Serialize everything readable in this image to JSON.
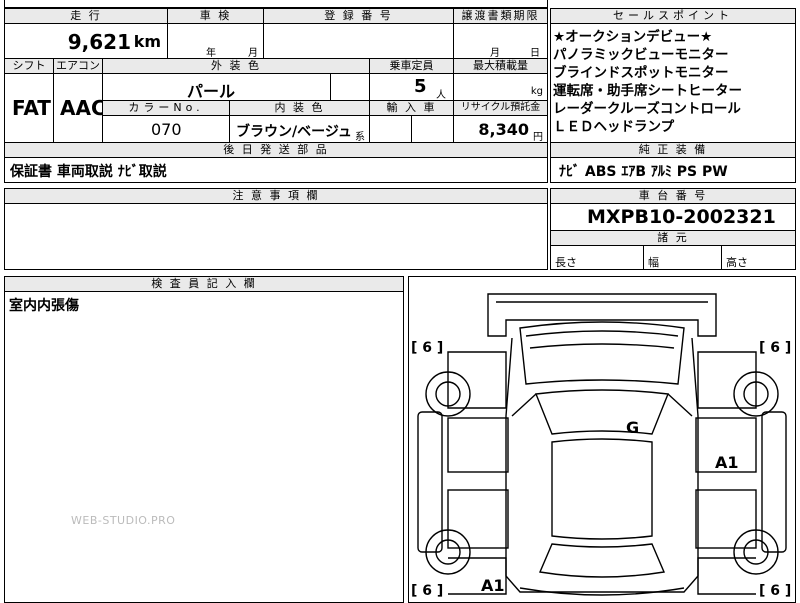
{
  "top_row": {
    "mileage_label": "走 行",
    "shaken_label": "車 検",
    "registration_label": "登 録 番 号",
    "transfer_label": "譲渡書類期限",
    "sales_label": "セールスポイント"
  },
  "mileage": {
    "value": "9,621",
    "unit": "km"
  },
  "shaken": {
    "year": "年",
    "month": "月"
  },
  "transfer": {
    "month": "月",
    "day": "日"
  },
  "row2": {
    "shift_label": "シフト",
    "ac_label": "エアコン",
    "ext_color_label": "外 装 色",
    "capacity_label": "乗車定員",
    "max_load_label": "最大積載量"
  },
  "shift": "FAT",
  "ac": "AAC",
  "ext_color": "パール",
  "capacity": {
    "value": "5",
    "unit": "人"
  },
  "max_load_unit": "kg",
  "row3": {
    "color_no_label": "カラーNo.",
    "int_color_label": "内 装 色",
    "import_label": "輸 入 車",
    "recycle_label": "リサイクル預託金"
  },
  "color_no": "070",
  "int_color": {
    "value": "ブラウン/ベージュ",
    "suffix": "系"
  },
  "recycle": {
    "value": "8,340",
    "unit": "円"
  },
  "later_parts_label": "後 日 発 送 部 品",
  "later_parts": "保証書 車両取説 ﾅﾋﾞ取説",
  "sales_points": [
    "★オークションデビュー★",
    "パノラミックビューモニター",
    "ブラインドスポットモニター",
    "運転席・助手席シートヒーター",
    "レーダークルーズコントロール",
    "ＬＥＤヘッドランプ"
  ],
  "genuine_equipment_label": "純 正 装 備",
  "genuine_equipment": "ﾅﾋﾞ ABS ｴｱB ｱﾙﾐ PS PW",
  "notes_label": "注 意 事 項 欄",
  "chassis_label": "車 台 番 号",
  "chassis_number": "MXPB10-2002321",
  "dimensions_label": "諸 元",
  "dimensions": {
    "length": "長さ",
    "width": "幅",
    "height": "高さ"
  },
  "inspector_label": "検 査 員 記 入 欄",
  "inspector_note": "室内内張傷",
  "watermark": "WEB-STUDIO.PRO",
  "diagram": {
    "tire_marks": [
      "[ 6 ]",
      "[ 6 ]",
      "[ 6 ]",
      "[ 6 ]"
    ],
    "damage_marks": [
      "G",
      "A1",
      "A1"
    ]
  }
}
